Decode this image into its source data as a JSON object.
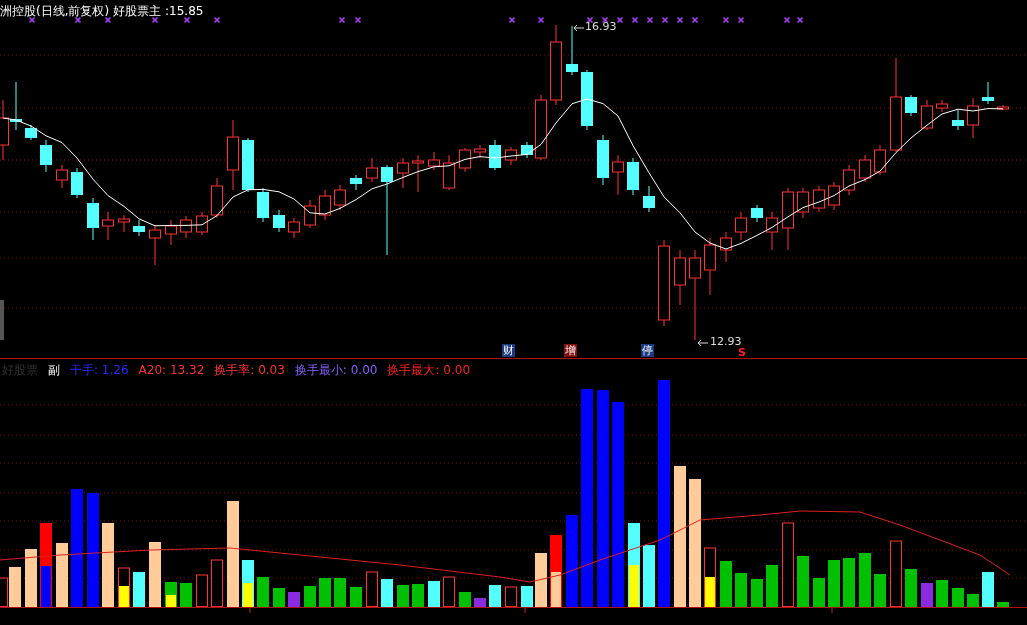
{
  "chart_title": {
    "stock": "洲控股(日线,前复权)",
    "indicator": "好股票主 :",
    "value": "15.85"
  },
  "price_labels": [
    {
      "kind": "high",
      "text": "16.93"
    },
    {
      "kind": "low",
      "text": "12.93"
    }
  ],
  "event_markers": [
    {
      "kind": "finance",
      "text": "财"
    },
    {
      "kind": "increase",
      "text": "增"
    },
    {
      "kind": "halt",
      "text": "停"
    },
    {
      "kind": "sell",
      "text": "S"
    }
  ],
  "sub_panel": {
    "name": "好股票",
    "label": "副",
    "readings": [
      {
        "label": "干手:",
        "value": "1.26",
        "color": "#2a2aff"
      },
      {
        "label": "A20:",
        "value": "13.32",
        "color": "#ff3232"
      },
      {
        "label": "换手率:",
        "value": "0.03",
        "color": "#ff3232"
      },
      {
        "label": "换手最小:",
        "value": "0.00",
        "color": "#8a5cff"
      },
      {
        "label": "换手最大:",
        "value": "0.00",
        "color": "#ff2020"
      }
    ]
  }
}
